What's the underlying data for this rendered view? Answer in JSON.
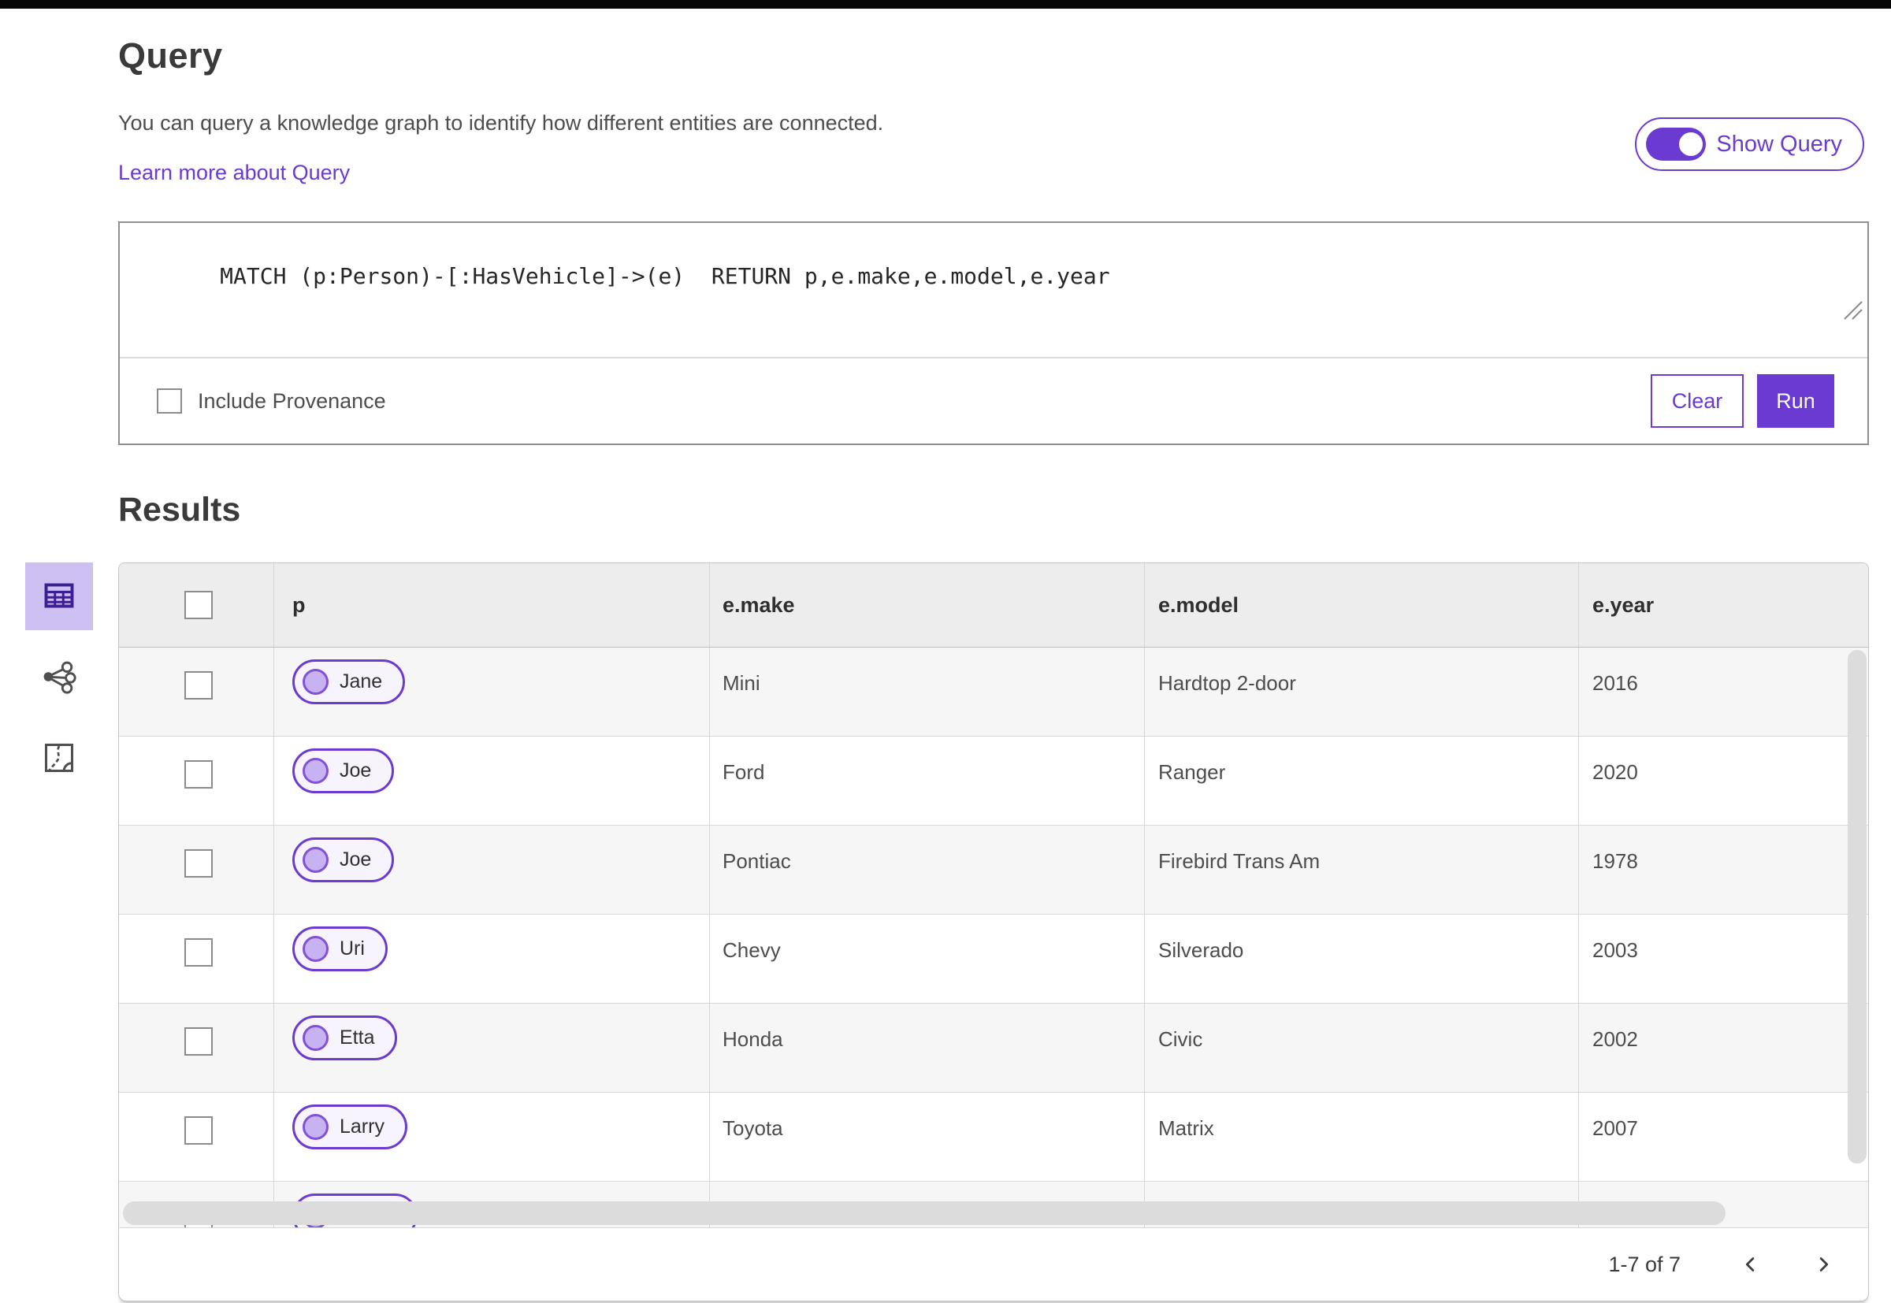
{
  "colors": {
    "accent": "#6a3ad1",
    "accent_soft": "#cfc0f2",
    "header_bg": "#ededed",
    "row_stripe": "#f6f6f6"
  },
  "query_panel": {
    "title": "Query",
    "description": "You can query a knowledge graph to identify how different entities are connected.",
    "learn_more_label": "Learn more about Query",
    "show_query_label": "Show Query",
    "query_text": "MATCH (p:Person)-[:HasVehicle]->(e)  RETURN p,e.make,e.model,e.year",
    "include_provenance_label": "Include Provenance",
    "clear_button_label": "Clear",
    "run_button_label": "Run"
  },
  "results_panel": {
    "title": "Results",
    "view_tabs": [
      {
        "name": "table-view",
        "icon": "table-icon",
        "active": true
      },
      {
        "name": "link-chart-view",
        "icon": "link-chart-icon",
        "active": false
      },
      {
        "name": "map-view",
        "icon": "map-icon",
        "active": false
      }
    ],
    "table": {
      "columns": [
        "p",
        "e.make",
        "e.model",
        "e.year"
      ],
      "rows": [
        {
          "p": "Jane",
          "make": "Mini",
          "model": "Hardtop 2-door",
          "year": "2016"
        },
        {
          "p": "Joe",
          "make": "Ford",
          "model": "Ranger",
          "year": "2020"
        },
        {
          "p": "Joe",
          "make": "Pontiac",
          "model": "Firebird Trans Am",
          "year": "1978"
        },
        {
          "p": "Uri",
          "make": "Chevy",
          "model": "Silverado",
          "year": "2003"
        },
        {
          "p": "Etta",
          "make": "Honda",
          "model": "Civic",
          "year": "2002"
        },
        {
          "p": "Larry",
          "make": "Toyota",
          "model": "Matrix",
          "year": "2007"
        }
      ]
    },
    "pagination": {
      "range_label": "1-7 of 7",
      "prev_icon": "chevron-left-icon",
      "next_icon": "chevron-right-icon"
    }
  }
}
